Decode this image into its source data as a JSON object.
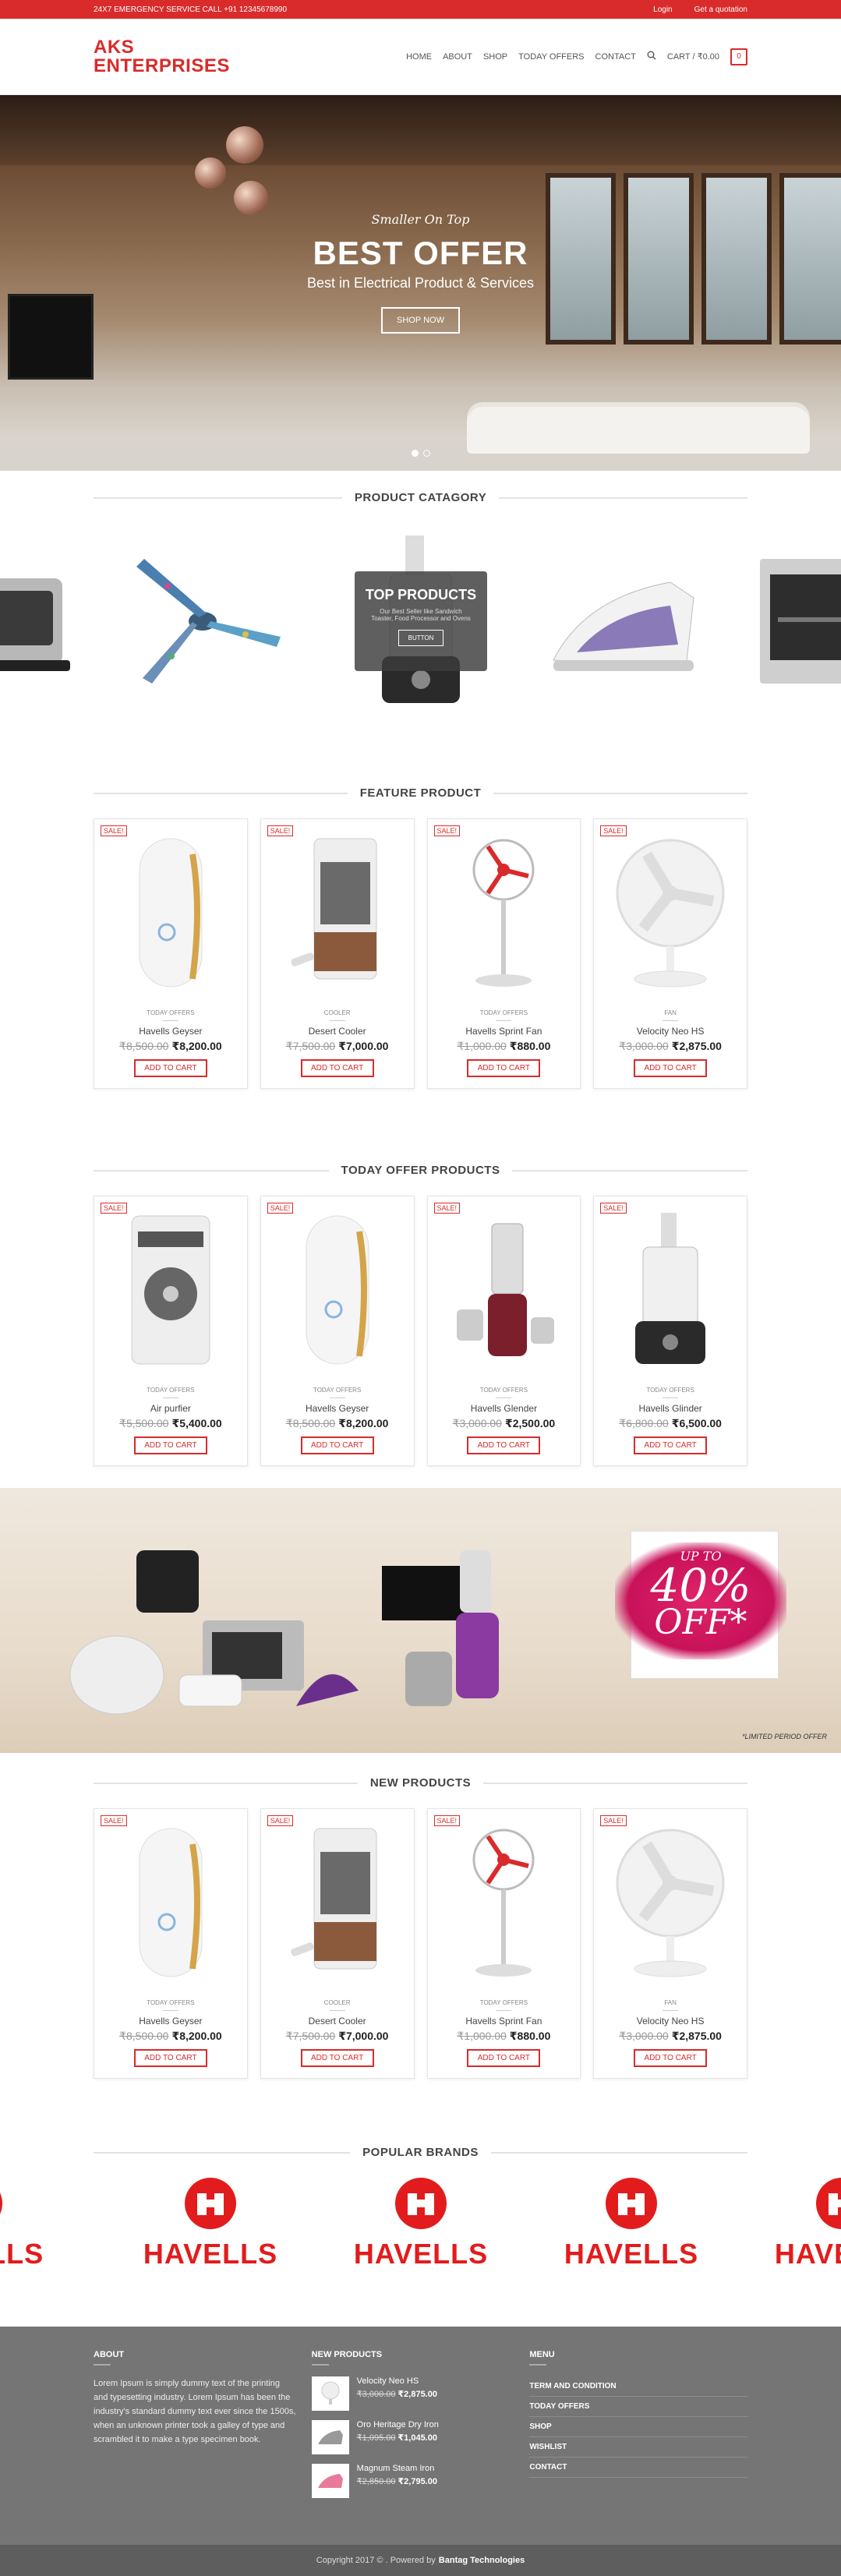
{
  "topbar": {
    "emergency": "24X7 EMERGENCY SERVICE CALL +91 12345678990",
    "login": "Login",
    "quote": "Get a quotation"
  },
  "header": {
    "logo_line1": "AKS",
    "logo_line2": "ENTERPRISES",
    "nav": [
      "HOME",
      "ABOUT",
      "SHOP",
      "TODAY OFFERS",
      "CONTACT"
    ],
    "cart_label": "CART / ₹0.00",
    "cart_count": "0"
  },
  "hero": {
    "script": "Smaller On Top",
    "title": "BEST OFFER",
    "subtitle": "Best in Electrical Product & Services",
    "button": "SHOP NOW"
  },
  "categories": {
    "title": "PRODUCT CATAGORY",
    "overlay_title": "TOP PRODUCTS",
    "overlay_text": "Our Best Seller like Sandwich Toaster, Food Processor and Ovens",
    "overlay_button": "BUTTON"
  },
  "feature": {
    "title": "FEATURE PRODUCT",
    "items": [
      {
        "sale": "SALE!",
        "category": "TODAY OFFERS",
        "name": "Havells Geyser",
        "old": "₹8,500.00",
        "new": "₹8,200.00",
        "button": "ADD TO CART"
      },
      {
        "sale": "SALE!",
        "category": "COOLER",
        "name": "Desert Cooler",
        "old": "₹7,500.00",
        "new": "₹7,000.00",
        "button": "ADD TO CART"
      },
      {
        "sale": "SALE!",
        "category": "TODAY OFFERS",
        "name": "Havells Sprint Fan",
        "old": "₹1,000.00",
        "new": "₹880.00",
        "button": "ADD TO CART"
      },
      {
        "sale": "SALE!",
        "category": "FAN",
        "name": "Velocity Neo HS",
        "old": "₹3,000.00",
        "new": "₹2,875.00",
        "button": "ADD TO CART"
      }
    ]
  },
  "today": {
    "title": "TODAY OFFER PRODUCTS",
    "items": [
      {
        "sale": "SALE!",
        "category": "TODAY OFFERS",
        "name": "Air purfier",
        "old": "₹5,500.00",
        "new": "₹5,400.00",
        "button": "ADD TO CART"
      },
      {
        "sale": "SALE!",
        "category": "TODAY OFFERS",
        "name": "Havells Geyser",
        "old": "₹8,500.00",
        "new": "₹8,200.00",
        "button": "ADD TO CART"
      },
      {
        "sale": "SALE!",
        "category": "TODAY OFFERS",
        "name": "Havells Glender",
        "old": "₹3,000.00",
        "new": "₹2,500.00",
        "button": "ADD TO CART"
      },
      {
        "sale": "SALE!",
        "category": "TODAY OFFERS",
        "name": "Havells Glinder",
        "old": "₹6,800.00",
        "new": "₹6,500.00",
        "button": "ADD TO CART"
      }
    ]
  },
  "promo": {
    "up_to": "UP TO",
    "percent": "40%",
    "off": "OFF*",
    "limited": "*LIMITED PERIOD OFFER"
  },
  "newprod": {
    "title": "NEW PRODUCTS",
    "items": [
      {
        "sale": "SALE!",
        "category": "TODAY OFFERS",
        "name": "Havells Geyser",
        "old": "₹8,500.00",
        "new": "₹8,200.00",
        "button": "ADD TO CART"
      },
      {
        "sale": "SALE!",
        "category": "COOLER",
        "name": "Desert Cooler",
        "old": "₹7,500.00",
        "new": "₹7,000.00",
        "button": "ADD TO CART"
      },
      {
        "sale": "SALE!",
        "category": "TODAY OFFERS",
        "name": "Havells Sprint Fan",
        "old": "₹1,000.00",
        "new": "₹880.00",
        "button": "ADD TO CART"
      },
      {
        "sale": "SALE!",
        "category": "FAN",
        "name": "Velocity Neo HS",
        "old": "₹3,000.00",
        "new": "₹2,875.00",
        "button": "ADD TO CART"
      }
    ]
  },
  "brands": {
    "title": "POPULAR BRANDS",
    "items": [
      "HAVELLS",
      "HAVELLS",
      "HAVELLS",
      "HAVELLS",
      "HAVELLS"
    ]
  },
  "footer": {
    "about_title": "ABOUT",
    "about_text": "Lorem Ipsum is simply dummy text of the printing and typesetting industry. Lorem Ipsum has been the industry's standard dummy text ever since the 1500s, when an unknown printer took a galley of type and scrambled it to make a type specimen book.",
    "new_title": "NEW PRODUCTS",
    "new_items": [
      {
        "name": "Velocity Neo HS",
        "old": "₹3,000.00",
        "new": "₹2,875.00"
      },
      {
        "name": "Oro Heritage Dry Iron",
        "old": "₹1,095.00",
        "new": "₹1,045.00"
      },
      {
        "name": "Magnum Steam Iron",
        "old": "₹2,850.00",
        "new": "₹2,795.00"
      }
    ],
    "menu_title": "MENU",
    "menu": [
      "TERM AND CONDITION",
      "TODAY OFFERS",
      "SHOP",
      "WISHLIST",
      "CONTACT"
    ],
    "copyright": "Copyright 2017 © . Powered by",
    "powered": "Bantag Technologies"
  },
  "colors": {
    "accent": "#d92b2b",
    "brand": "#e21c1c",
    "footer": "#757575"
  }
}
